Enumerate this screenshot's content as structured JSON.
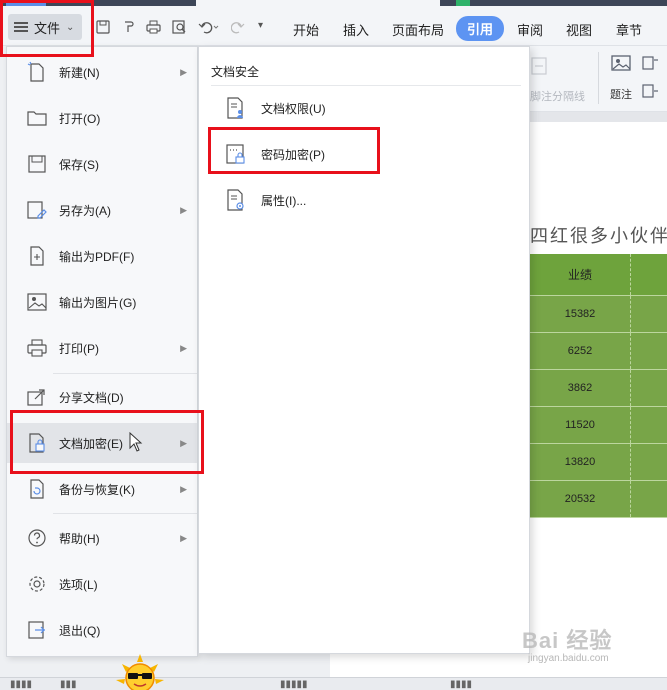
{
  "menubar": {
    "file_label": "文件",
    "tabs": [
      "开始",
      "插入",
      "页面布局",
      "引用",
      "审阅",
      "视图",
      "章节"
    ],
    "active_tab": "引用"
  },
  "ribbon": {
    "partial_label": "题注",
    "muted_label": "脚注分隔线"
  },
  "file_menu": {
    "items": [
      {
        "label": "新建(N)",
        "icon": "new-doc-icon",
        "has_submenu": true
      },
      {
        "label": "打开(O)",
        "icon": "folder-open-icon",
        "has_submenu": false
      },
      {
        "label": "保存(S)",
        "icon": "save-icon",
        "has_submenu": false
      },
      {
        "label": "另存为(A)",
        "icon": "save-as-icon",
        "has_submenu": true
      },
      {
        "label": "输出为PDF(F)",
        "icon": "pdf-export-icon",
        "has_submenu": false
      },
      {
        "label": "输出为图片(G)",
        "icon": "image-export-icon",
        "has_submenu": false
      },
      {
        "label": "打印(P)",
        "icon": "printer-icon",
        "has_submenu": true
      },
      {
        "label": "分享文档(D)",
        "icon": "share-icon",
        "has_submenu": false
      },
      {
        "label": "文档加密(E)",
        "icon": "doc-encrypt-icon",
        "has_submenu": true
      },
      {
        "label": "备份与恢复(K)",
        "icon": "backup-icon",
        "has_submenu": true
      },
      {
        "label": "帮助(H)",
        "icon": "help-icon",
        "has_submenu": true
      },
      {
        "label": "选项(L)",
        "icon": "gear-icon",
        "has_submenu": false
      },
      {
        "label": "退出(Q)",
        "icon": "exit-icon",
        "has_submenu": false
      }
    ]
  },
  "submenu": {
    "title": "文档安全",
    "items": [
      {
        "label": "文档权限(U)",
        "icon": "doc-permission-icon"
      },
      {
        "label": "密码加密(P)",
        "icon": "password-lock-icon"
      },
      {
        "label": "属性(I)...",
        "icon": "doc-properties-icon"
      }
    ]
  },
  "document": {
    "heading_fragment": "四红很多小伙伴都",
    "table_header": "业绩",
    "table_values": [
      "15382",
      "6252",
      "3862",
      "11520",
      "13820",
      "20532"
    ]
  },
  "watermark": {
    "brand": "Bai 经验",
    "url": "jingyan.baidu.com"
  },
  "colors": {
    "accent_tab": "#5d94f2",
    "highlight_box": "#e8101b",
    "table_green": "#78a548"
  }
}
